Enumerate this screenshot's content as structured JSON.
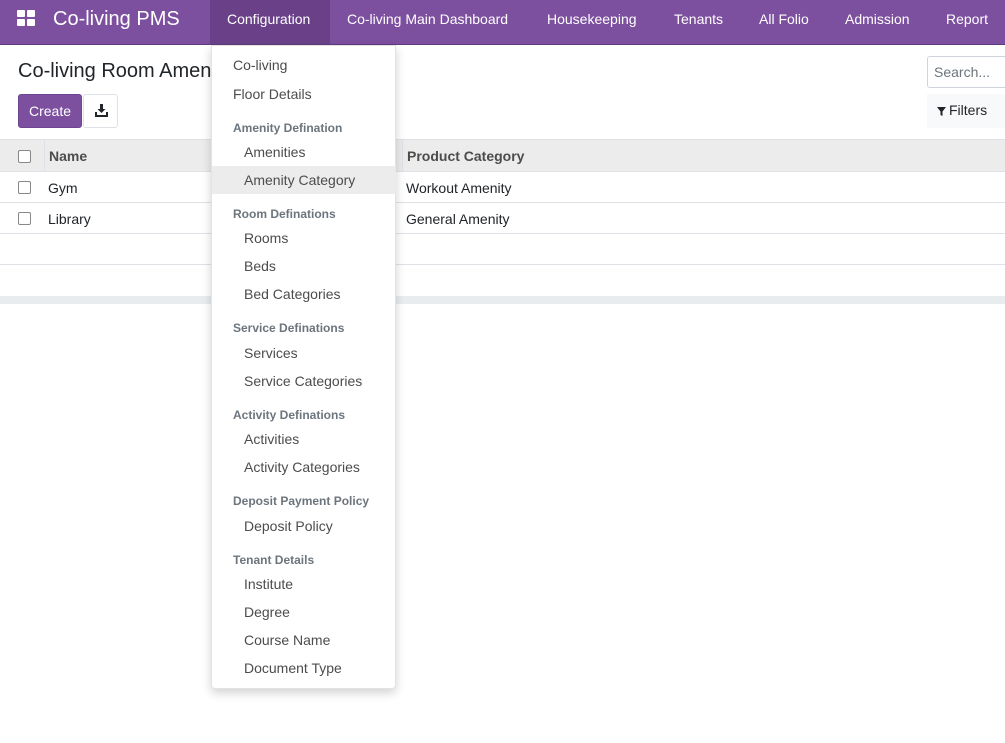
{
  "navbar": {
    "brand": "Co-living PMS",
    "items": [
      {
        "label": "Configuration"
      },
      {
        "label": "Co-living Main Dashboard"
      },
      {
        "label": "Housekeeping"
      },
      {
        "label": "Tenants"
      },
      {
        "label": "All Folio"
      },
      {
        "label": "Admission"
      },
      {
        "label": "Report"
      }
    ]
  },
  "control_panel": {
    "title": "Co-living Room Amen",
    "create_label": "Create",
    "search_placeholder": "Search...",
    "filters_label": "Filters"
  },
  "list": {
    "columns": [
      "Name",
      "Product Category"
    ],
    "rows": [
      {
        "name": "Gym",
        "product_category": "Workout Amenity"
      },
      {
        "name": "Library",
        "product_category": "General Amenity"
      }
    ]
  },
  "dropdown": {
    "co_living": "Co-living",
    "floor_details": "Floor Details",
    "amenity_header": "Amenity Defination",
    "amenities": "Amenities",
    "amenity_category": "Amenity Category",
    "room_header": "Room Definations",
    "rooms": "Rooms",
    "beds": "Beds",
    "bed_categories": "Bed Categories",
    "service_header": "Service Definations",
    "services": "Services",
    "service_categories": "Service Categories",
    "activity_header": "Activity Definations",
    "activities": "Activities",
    "activity_categories": "Activity Categories",
    "deposit_header": "Deposit Payment Policy",
    "deposit_policy": "Deposit Policy",
    "tenant_header": "Tenant Details",
    "institute": "Institute",
    "degree": "Degree",
    "course_name": "Course Name",
    "document_type": "Document Type"
  },
  "colors": {
    "brand": "#7c4f9f",
    "active_nav": "#6a4189",
    "hover_item": "#ececec"
  }
}
